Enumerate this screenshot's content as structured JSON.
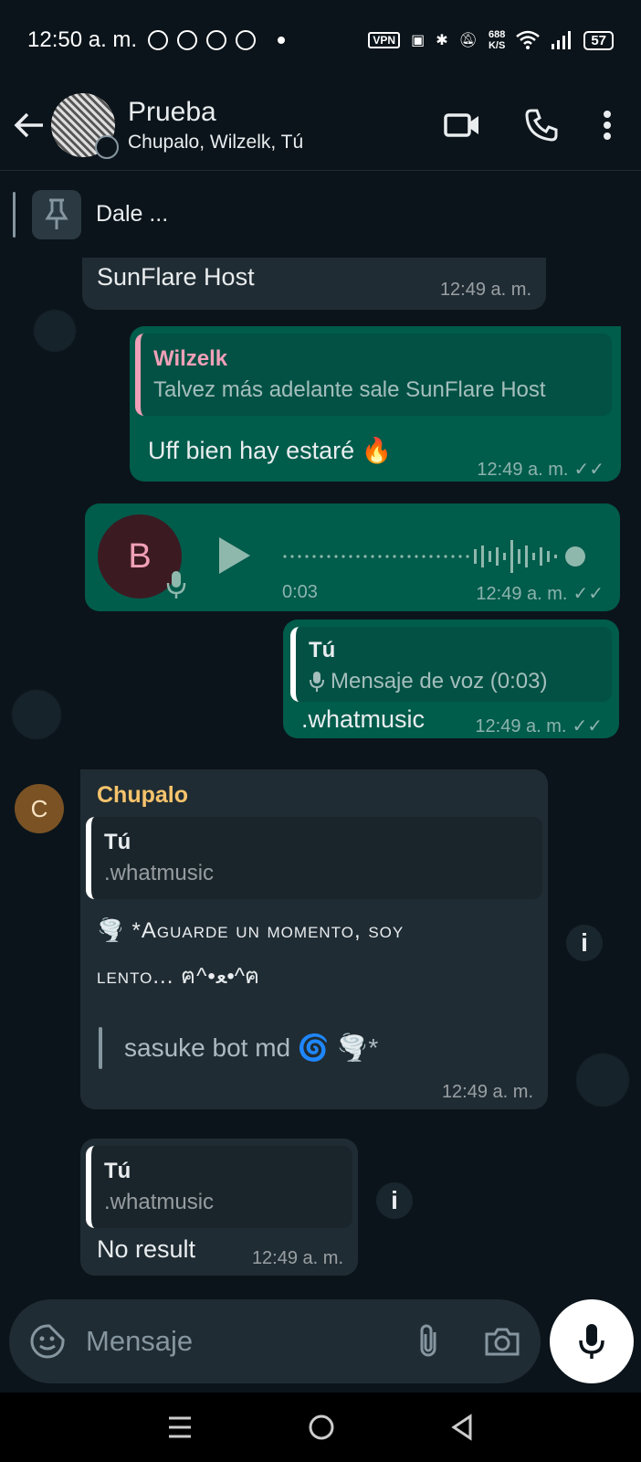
{
  "status_bar": {
    "time": "12:50 a. m.",
    "vpn": "VPN",
    "speed_value": "688",
    "speed_unit": "K/S",
    "battery": "57"
  },
  "header": {
    "title": "Prueba",
    "subtitle": "Chupalo, Wilzelk, Tú"
  },
  "pinned": {
    "text": "Dale ..."
  },
  "messages": {
    "m1": {
      "text": "SunFlare Host",
      "time": "12:49 a. m."
    },
    "m2": {
      "quote_name": "Wilzelk",
      "quote_text": "Talvez más adelante sale SunFlare Host",
      "text": "Uff bien hay estaré 🔥",
      "time": "12:49 a. m.",
      "ticks": "✓✓"
    },
    "m3": {
      "avatar_letter": "B",
      "duration": "0:03",
      "time": "12:49 a. m.",
      "ticks": "✓✓"
    },
    "m4": {
      "quote_name": "Tú",
      "quote_text": "Mensaje de voz (0:03)",
      "text": ".whatmusic",
      "time": "12:49 a. m.",
      "ticks": "✓✓"
    },
    "m5": {
      "avatar_letter": "C",
      "sender": "Chupalo",
      "quote_name": "Tú",
      "quote_text": ".whatmusic",
      "line1": "🌪️ *Aguarde un momento, soy",
      "line2": "lento... ฅ^•ﻌ•^ฅ",
      "line3": "sasuke bot md 🌀 🌪️*",
      "time": "12:49 a. m."
    },
    "m6": {
      "quote_name": "Tú",
      "quote_text": ".whatmusic",
      "text": "No result",
      "time": "12:49 a. m."
    }
  },
  "input": {
    "placeholder": "Mensaje"
  },
  "colors": {
    "background": "#0b141a",
    "incoming": "#202c33",
    "outgoing": "#005c4b",
    "wilzelk": "#f0a0b8",
    "chupalo": "#f7c46c"
  }
}
